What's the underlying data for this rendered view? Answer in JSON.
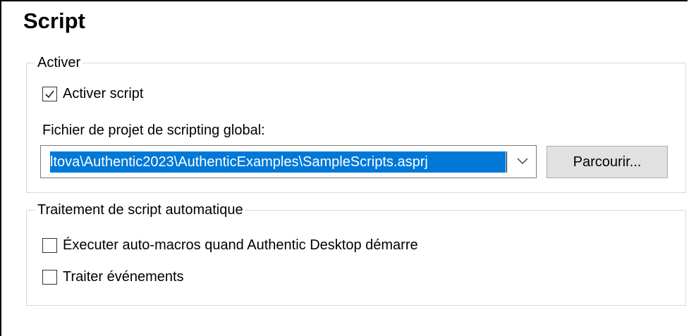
{
  "page": {
    "title": "Script"
  },
  "activer": {
    "legend": "Activer",
    "enable_script": {
      "label": "Activer script",
      "checked": true
    },
    "global_project_label": "Fichier de projet de scripting global:",
    "global_project_value": "ltova\\Authentic2023\\AuthenticExamples\\SampleScripts.asprj",
    "browse_label": "Parcourir..."
  },
  "traitement": {
    "legend": "Traitement de script automatique",
    "run_automacros": {
      "label": "Éxecuter auto-macros quand Authentic Desktop démarre",
      "checked": false
    },
    "process_events": {
      "label": "Traiter événements",
      "checked": false
    }
  },
  "icons": {
    "checkmark": "checkmark-icon",
    "dropdown": "chevron-down-icon"
  },
  "colors": {
    "selection": "#0078d7",
    "button_bg": "#e1e1e1",
    "group_border": "#d9d9d9"
  }
}
